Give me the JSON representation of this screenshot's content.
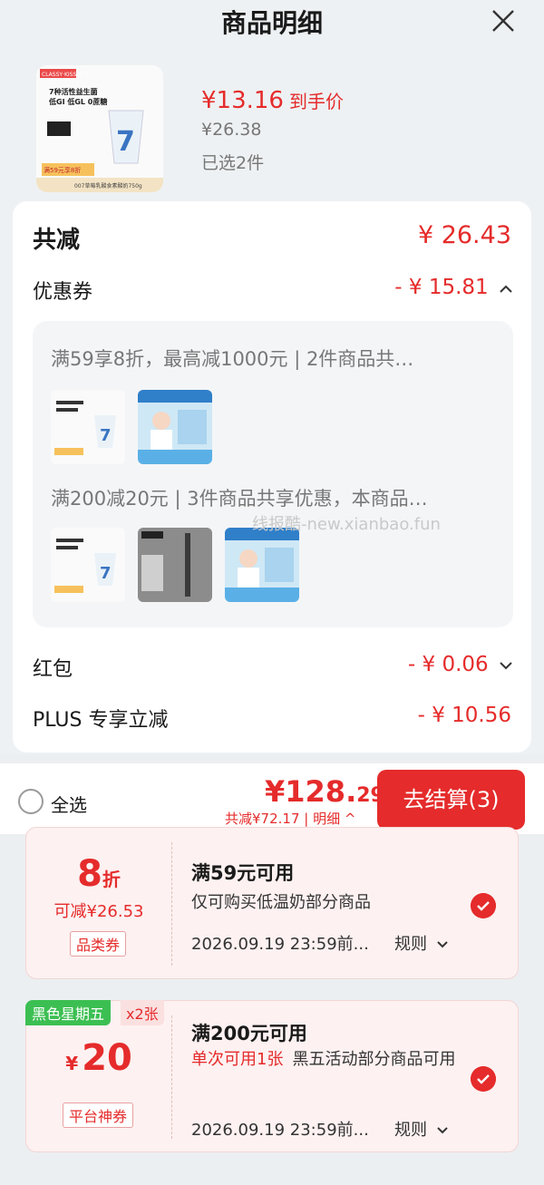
{
  "header": {
    "title": "商品明细"
  },
  "product": {
    "price_now": "¥13.16",
    "price_now_tag": "到手价",
    "price_old": "¥26.38",
    "selected": "已选2件",
    "thumb_brand": "CLASSY·KISS 卡士",
    "thumb_line1": "7种活性益生菌",
    "thumb_line2": "低GI 低GL 0蔗糖",
    "thumb_promo": "满59元享8折",
    "thumb_footer": "007草莓乳酸食素酸奶750g"
  },
  "savings": {
    "total_label": "共减",
    "total_value": "¥ 26.43",
    "coupon_label": "优惠券",
    "coupon_value": "- ¥ 15.81",
    "promo1": "满59享8折，最高减1000元 | 2件商品共…",
    "promo2": "满200减20元 | 3件商品共享优惠，本商品…",
    "hongbao_label": "红包",
    "hongbao_value": "- ¥ 0.06",
    "plus_label": "PLUS 专享立减",
    "plus_value": "- ¥ 10.56"
  },
  "watermark": "线报酷-new.xianbao.fun",
  "bottom_bar": {
    "select_all": "全选",
    "sum_int": "¥128.",
    "sum_dec": "29",
    "sum_sub": "共减¥72.17 | 明细 ^",
    "checkout": "去结算(3)"
  },
  "coupons": [
    {
      "big": "8",
      "big_unit": "折",
      "reduce": "可减¥26.53",
      "chip": "品类券",
      "title": "满59元可用",
      "desc": "仅可购买低温奶部分商品",
      "date": "2026.09.19 23:59前...",
      "rule": "规则"
    },
    {
      "badge": "黑色星期五",
      "badge_count": "x2张",
      "big_prefix": "¥",
      "big": "20",
      "chip": "平台神券",
      "title": "满200元可用",
      "desc_red": "单次可用1张",
      "desc": "黑五活动部分商品可用",
      "date": "2026.09.19 23:59前...",
      "rule": "规则"
    }
  ],
  "colors": {
    "accent": "#e52b2b",
    "badge_green": "#3cbf52"
  }
}
